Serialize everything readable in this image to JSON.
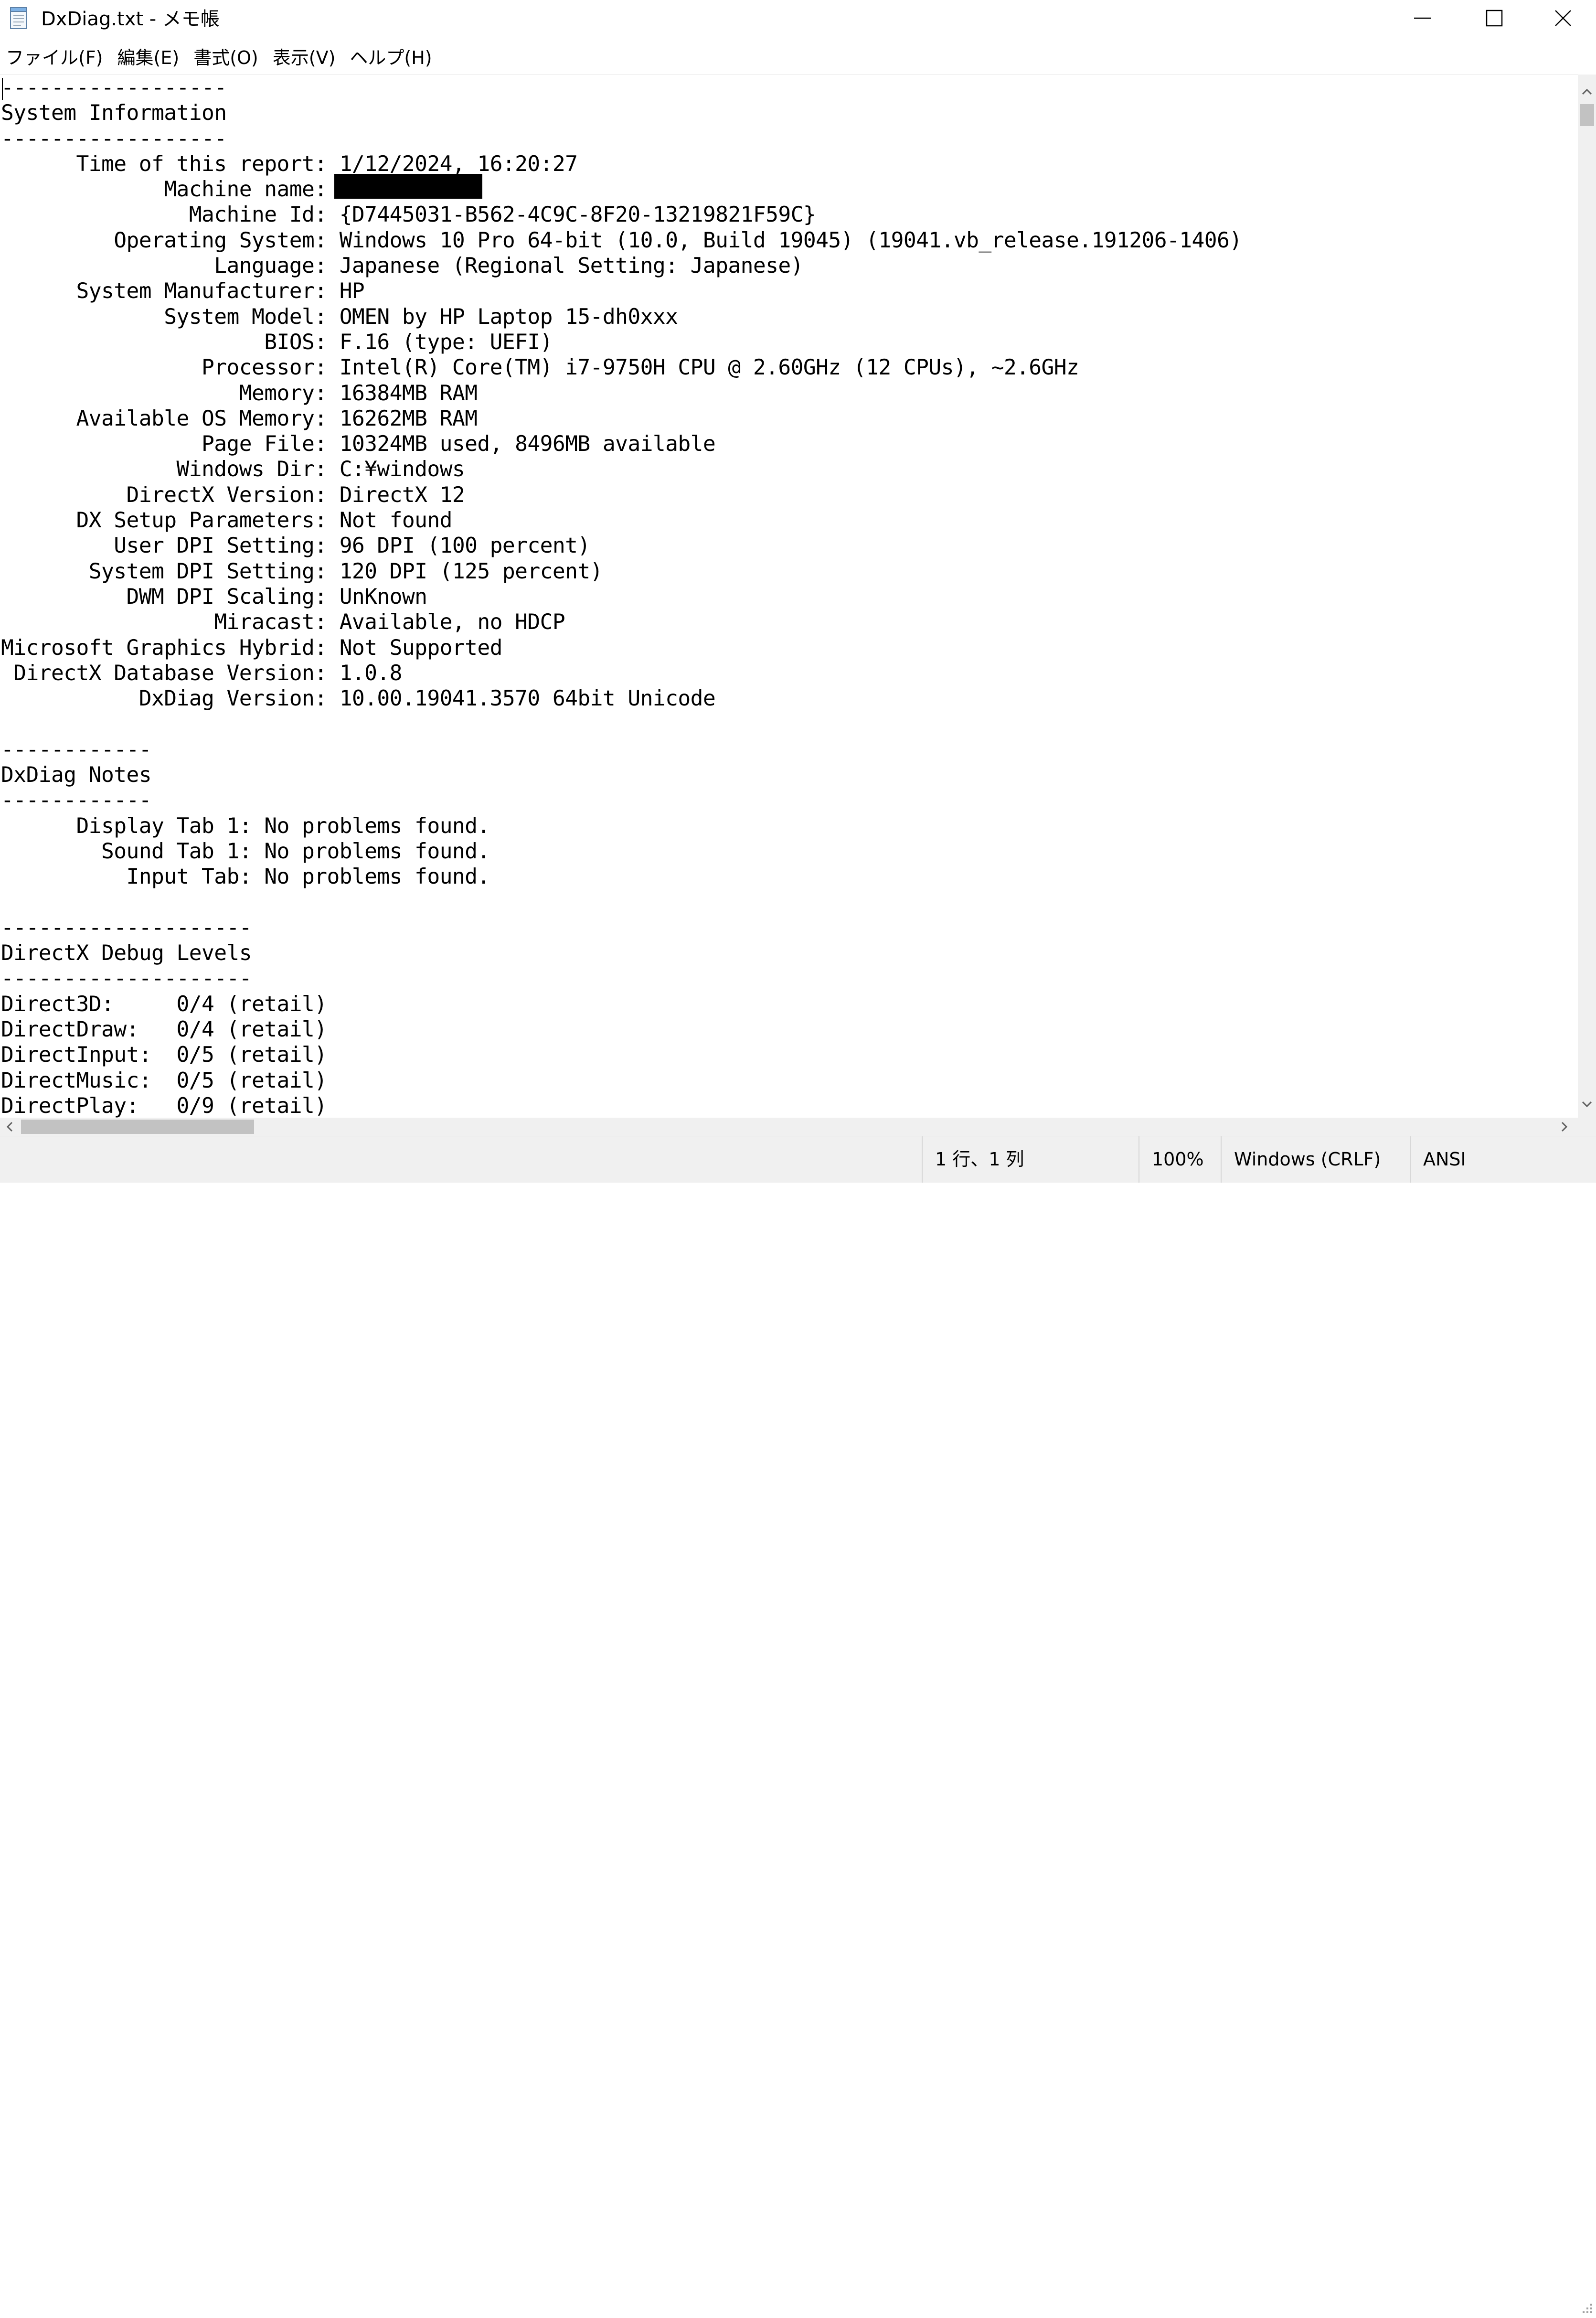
{
  "window": {
    "title": "DxDiag.txt - メモ帳"
  },
  "menu": {
    "items": [
      "ファイル(F)",
      "編集(E)",
      "書式(O)",
      "表示(V)",
      "ヘルプ(H)"
    ]
  },
  "document": {
    "text": "------------------\nSystem Information\n------------------\n      Time of this report: 1/12/2024, 16:20:27\n             Machine name: \n               Machine Id: {D7445031-B562-4C9C-8F20-13219821F59C}\n         Operating System: Windows 10 Pro 64-bit (10.0, Build 19045) (19041.vb_release.191206-1406)\n                 Language: Japanese (Regional Setting: Japanese)\n      System Manufacturer: HP\n             System Model: OMEN by HP Laptop 15-dh0xxx\n                     BIOS: F.16 (type: UEFI)\n                Processor: Intel(R) Core(TM) i7-9750H CPU @ 2.60GHz (12 CPUs), ~2.6GHz\n                   Memory: 16384MB RAM\n      Available OS Memory: 16262MB RAM\n                Page File: 10324MB used, 8496MB available\n              Windows Dir: C:¥windows\n          DirectX Version: DirectX 12\n      DX Setup Parameters: Not found\n         User DPI Setting: 96 DPI (100 percent)\n       System DPI Setting: 120 DPI (125 percent)\n          DWM DPI Scaling: UnKnown\n                 Miracast: Available, no HDCP\nMicrosoft Graphics Hybrid: Not Supported\n DirectX Database Version: 1.0.8\n           DxDiag Version: 10.00.19041.3570 64bit Unicode\n\n------------\nDxDiag Notes\n------------\n      Display Tab 1: No problems found.\n        Sound Tab 1: No problems found.\n          Input Tab: No problems found.\n\n--------------------\nDirectX Debug Levels\n--------------------\nDirect3D:     0/4 (retail)\nDirectDraw:   0/4 (retail)\nDirectInput:  0/5 (retail)\nDirectMusic:  0/5 (retail)\nDirectPlay:   0/9 (retail)"
  },
  "status": {
    "position": "1 行、1 列",
    "zoom": "100%",
    "line_ending": "Windows (CRLF)",
    "encoding": "ANSI"
  }
}
